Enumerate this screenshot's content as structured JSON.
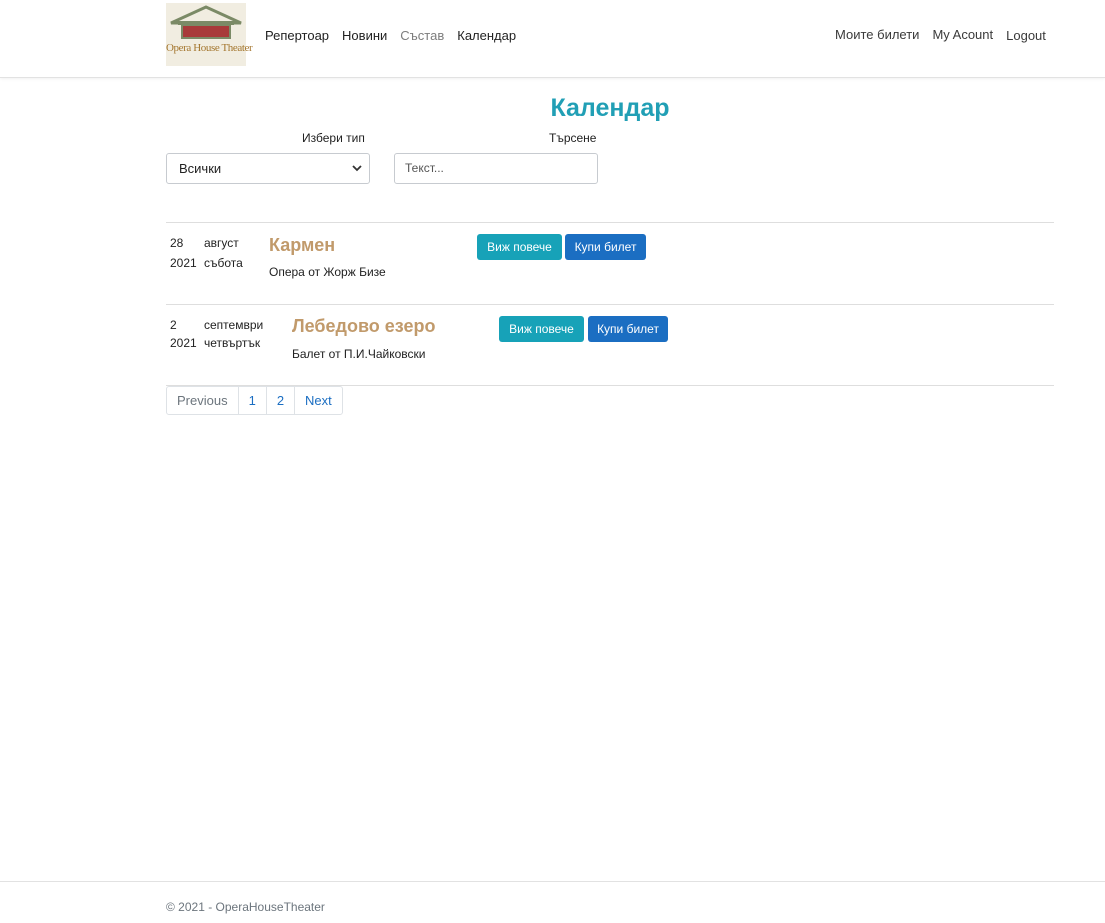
{
  "brand": {
    "logo_text": "Opera House Theater"
  },
  "nav": {
    "left": [
      {
        "label": "Репертоар",
        "muted": false
      },
      {
        "label": "Новини",
        "muted": false
      },
      {
        "label": "Състав",
        "muted": true
      },
      {
        "label": "Календар",
        "muted": false
      }
    ],
    "right": [
      {
        "label": "Моите билети"
      },
      {
        "label": "My Acount"
      },
      {
        "label": "Logout"
      }
    ]
  },
  "page": {
    "title": "Календар"
  },
  "filters": {
    "type_label": "Избери тип",
    "type_value": "Всички",
    "search_label": "Търсене",
    "search_placeholder": "Текст..."
  },
  "events": [
    {
      "day": "28",
      "year": "2021",
      "month": "август",
      "weekday": "събота",
      "title": "Кармен",
      "subtitle": "Опера от Жорж Бизе",
      "more_label": "Виж повече",
      "buy_label": "Купи билет"
    },
    {
      "day": "2",
      "year": "2021",
      "month": "септември",
      "weekday": "четвъртък",
      "title": "Лебедово езеро",
      "subtitle": "Балет от П.И.Чайковски",
      "more_label": "Виж повече",
      "buy_label": "Купи билет"
    }
  ],
  "pagination": {
    "items": [
      "Previous",
      "1",
      "2",
      "Next"
    ]
  },
  "footer": {
    "text": "© 2021 - OperaHouseTheater"
  },
  "colors": {
    "accent": "#219fb5",
    "event_title": "#c19a6b",
    "info_button": "#17a2b8",
    "primary_button": "#1b6ec2"
  },
  "icons": [
    "theater-roof-logo",
    "chevron-down-icon"
  ]
}
